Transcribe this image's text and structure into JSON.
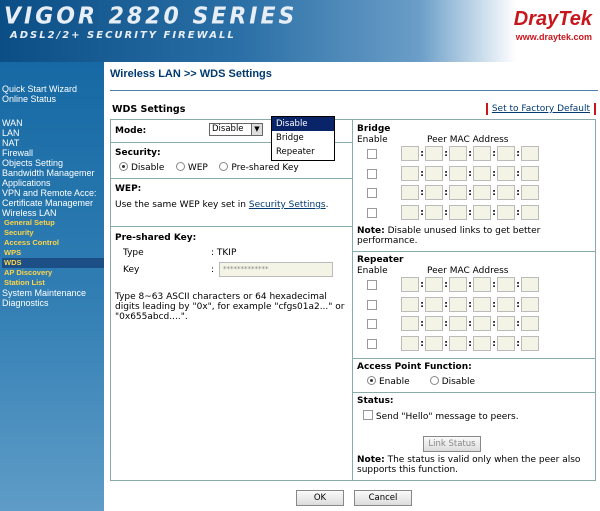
{
  "banner": {
    "title": "VIGOR 2820 SERIES",
    "subtitle": "ADSL2/2+ SECURITY FIREWALL",
    "logo": "DrayTek",
    "url": "www.draytek.com"
  },
  "sidebar": {
    "top": [
      "Quick Start Wizard",
      "Online Status"
    ],
    "items": [
      "WAN",
      "LAN",
      "NAT",
      "Firewall",
      "Objects Setting",
      "Bandwidth Managemer",
      "Applications",
      "VPN and Remote Acce:",
      "Certificate Managemer",
      "Wireless LAN"
    ],
    "subitems": [
      "General Setup",
      "Security",
      "Access Control",
      "WPS",
      "WDS",
      "AP Discovery",
      "Station List"
    ],
    "selected_sub": "WDS",
    "bottom": [
      "System Maintenance",
      "Diagnostics"
    ]
  },
  "page": {
    "title": "Wireless LAN >> WDS Settings",
    "section": "WDS Settings",
    "factory_link": "Set to Factory Default"
  },
  "mode": {
    "label": "Mode:",
    "value": "Disable",
    "options": [
      "Disable",
      "Bridge",
      "Repeater"
    ],
    "highlighted": "Disable"
  },
  "security": {
    "label": "Security:",
    "options": [
      "Disable",
      "WEP",
      "Pre-shared Key"
    ],
    "selected": "Disable"
  },
  "wep": {
    "label": "WEP:",
    "text_pre": "Use the same WEP key set in ",
    "link": "Security Settings",
    "text_post": "."
  },
  "psk": {
    "label": "Pre-shared Key:",
    "type_label": "Type",
    "type_value": ": TKIP",
    "key_label": "Key",
    "key_sep": ":",
    "key_value": "*************",
    "note": "Type 8~63 ASCII characters or 64 hexadecimal digits leading by \"0x\", for example \"cfgs01a2...\" or \"0x655abcd....\"."
  },
  "bridge": {
    "label": "Bridge",
    "enable": "Enable",
    "peer": "Peer MAC Address",
    "note_label": "Note:",
    "note": " Disable unused links to get better performance."
  },
  "repeater": {
    "label": "Repeater",
    "enable": "Enable",
    "peer": "Peer MAC Address"
  },
  "ap_function": {
    "label": "Access Point Function:",
    "options": [
      "Enable",
      "Disable"
    ],
    "selected": "Enable"
  },
  "status": {
    "label": "Status:",
    "hello": "Send \"Hello\" message to peers.",
    "link_status": "Link Status",
    "note_label": "Note:",
    "note": " The status is valid only when the peer also supports this function."
  },
  "buttons": {
    "ok": "OK",
    "cancel": "Cancel"
  },
  "colors": {
    "accent": "#003a70",
    "brand": "#c8161d",
    "sidebar": "#2f7db3",
    "menu_highlight": "#0a246a"
  }
}
